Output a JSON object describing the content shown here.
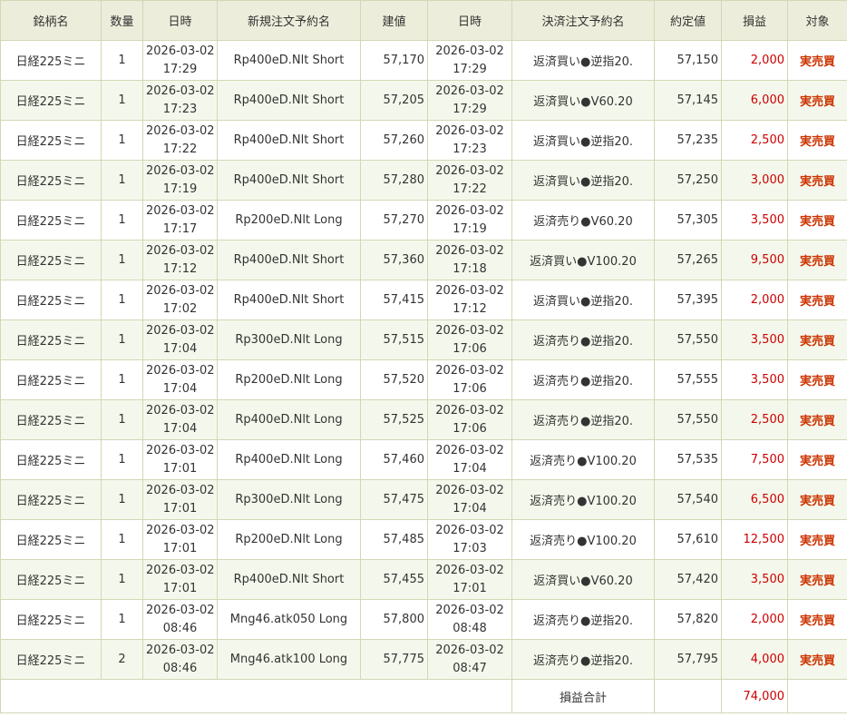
{
  "headers": [
    "銘柄名",
    "数量",
    "日時",
    "新規注文予約名",
    "建値",
    "日時",
    "決済注文予約名",
    "約定値",
    "損益",
    "対象"
  ],
  "rows": [
    {
      "symbol": "日経225ミニ",
      "qty": "1",
      "open_date": "2026-03-02",
      "open_time": "17:29",
      "open_order": "Rp400eD.Nlt Short",
      "open_price": "57,170",
      "close_date": "2026-03-02",
      "close_time": "17:29",
      "close_order": "返済買い●逆指20.",
      "close_price": "57,150",
      "pnl": "2,000",
      "target": "実売買"
    },
    {
      "symbol": "日経225ミニ",
      "qty": "1",
      "open_date": "2026-03-02",
      "open_time": "17:23",
      "open_order": "Rp400eD.Nlt Short",
      "open_price": "57,205",
      "close_date": "2026-03-02",
      "close_time": "17:29",
      "close_order": "返済買い●V60.20",
      "close_price": "57,145",
      "pnl": "6,000",
      "target": "実売買"
    },
    {
      "symbol": "日経225ミニ",
      "qty": "1",
      "open_date": "2026-03-02",
      "open_time": "17:22",
      "open_order": "Rp400eD.Nlt Short",
      "open_price": "57,260",
      "close_date": "2026-03-02",
      "close_time": "17:23",
      "close_order": "返済買い●逆指20.",
      "close_price": "57,235",
      "pnl": "2,500",
      "target": "実売買"
    },
    {
      "symbol": "日経225ミニ",
      "qty": "1",
      "open_date": "2026-03-02",
      "open_time": "17:19",
      "open_order": "Rp400eD.Nlt Short",
      "open_price": "57,280",
      "close_date": "2026-03-02",
      "close_time": "17:22",
      "close_order": "返済買い●逆指20.",
      "close_price": "57,250",
      "pnl": "3,000",
      "target": "実売買"
    },
    {
      "symbol": "日経225ミニ",
      "qty": "1",
      "open_date": "2026-03-02",
      "open_time": "17:17",
      "open_order": "Rp200eD.Nlt Long",
      "open_price": "57,270",
      "close_date": "2026-03-02",
      "close_time": "17:19",
      "close_order": "返済売り●V60.20",
      "close_price": "57,305",
      "pnl": "3,500",
      "target": "実売買"
    },
    {
      "symbol": "日経225ミニ",
      "qty": "1",
      "open_date": "2026-03-02",
      "open_time": "17:12",
      "open_order": "Rp400eD.Nlt Short",
      "open_price": "57,360",
      "close_date": "2026-03-02",
      "close_time": "17:18",
      "close_order": "返済買い●V100.20",
      "close_price": "57,265",
      "pnl": "9,500",
      "target": "実売買"
    },
    {
      "symbol": "日経225ミニ",
      "qty": "1",
      "open_date": "2026-03-02",
      "open_time": "17:02",
      "open_order": "Rp400eD.Nlt Short",
      "open_price": "57,415",
      "close_date": "2026-03-02",
      "close_time": "17:12",
      "close_order": "返済買い●逆指20.",
      "close_price": "57,395",
      "pnl": "2,000",
      "target": "実売買"
    },
    {
      "symbol": "日経225ミニ",
      "qty": "1",
      "open_date": "2026-03-02",
      "open_time": "17:04",
      "open_order": "Rp300eD.Nlt Long",
      "open_price": "57,515",
      "close_date": "2026-03-02",
      "close_time": "17:06",
      "close_order": "返済売り●逆指20.",
      "close_price": "57,550",
      "pnl": "3,500",
      "target": "実売買"
    },
    {
      "symbol": "日経225ミニ",
      "qty": "1",
      "open_date": "2026-03-02",
      "open_time": "17:04",
      "open_order": "Rp200eD.Nlt Long",
      "open_price": "57,520",
      "close_date": "2026-03-02",
      "close_time": "17:06",
      "close_order": "返済売り●逆指20.",
      "close_price": "57,555",
      "pnl": "3,500",
      "target": "実売買"
    },
    {
      "symbol": "日経225ミニ",
      "qty": "1",
      "open_date": "2026-03-02",
      "open_time": "17:04",
      "open_order": "Rp400eD.Nlt Long",
      "open_price": "57,525",
      "close_date": "2026-03-02",
      "close_time": "17:06",
      "close_order": "返済売り●逆指20.",
      "close_price": "57,550",
      "pnl": "2,500",
      "target": "実売買"
    },
    {
      "symbol": "日経225ミニ",
      "qty": "1",
      "open_date": "2026-03-02",
      "open_time": "17:01",
      "open_order": "Rp400eD.Nlt Long",
      "open_price": "57,460",
      "close_date": "2026-03-02",
      "close_time": "17:04",
      "close_order": "返済売り●V100.20",
      "close_price": "57,535",
      "pnl": "7,500",
      "target": "実売買"
    },
    {
      "symbol": "日経225ミニ",
      "qty": "1",
      "open_date": "2026-03-02",
      "open_time": "17:01",
      "open_order": "Rp300eD.Nlt Long",
      "open_price": "57,475",
      "close_date": "2026-03-02",
      "close_time": "17:04",
      "close_order": "返済売り●V100.20",
      "close_price": "57,540",
      "pnl": "6,500",
      "target": "実売買"
    },
    {
      "symbol": "日経225ミニ",
      "qty": "1",
      "open_date": "2026-03-02",
      "open_time": "17:01",
      "open_order": "Rp200eD.Nlt Long",
      "open_price": "57,485",
      "close_date": "2026-03-02",
      "close_time": "17:03",
      "close_order": "返済売り●V100.20",
      "close_price": "57,610",
      "pnl": "12,500",
      "target": "実売買"
    },
    {
      "symbol": "日経225ミニ",
      "qty": "1",
      "open_date": "2026-03-02",
      "open_time": "17:01",
      "open_order": "Rp400eD.Nlt Short",
      "open_price": "57,455",
      "close_date": "2026-03-02",
      "close_time": "17:01",
      "close_order": "返済買い●V60.20",
      "close_price": "57,420",
      "pnl": "3,500",
      "target": "実売買"
    },
    {
      "symbol": "日経225ミニ",
      "qty": "1",
      "open_date": "2026-03-02",
      "open_time": "08:46",
      "open_order": "Mng46.atk050 Long",
      "open_price": "57,800",
      "close_date": "2026-03-02",
      "close_time": "08:48",
      "close_order": "返済売り●逆指20.",
      "close_price": "57,820",
      "pnl": "2,000",
      "target": "実売買"
    },
    {
      "symbol": "日経225ミニ",
      "qty": "2",
      "open_date": "2026-03-02",
      "open_time": "08:46",
      "open_order": "Mng46.atk100 Long",
      "open_price": "57,775",
      "close_date": "2026-03-02",
      "close_time": "08:47",
      "close_order": "返済売り●逆指20.",
      "close_price": "57,795",
      "pnl": "4,000",
      "target": "実売買"
    }
  ],
  "total": {
    "label": "損益合計",
    "value": "74,000"
  },
  "colors": {
    "header_bg": "#ededdb",
    "stripe_bg": "#f4f8ec",
    "border": "#d3d7b5",
    "profit": "#cc0000",
    "target": "#cc3300"
  }
}
